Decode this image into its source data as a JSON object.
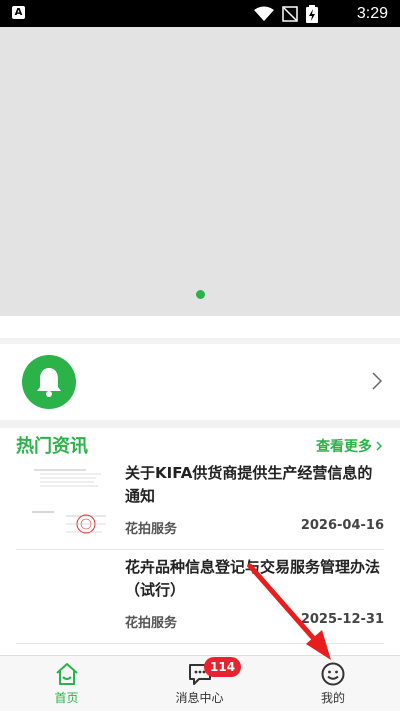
{
  "status_bar": {
    "app_icon_letter": "A",
    "time": "3:29",
    "icons": [
      "wifi-icon",
      "no-signal-icon",
      "battery-charging-icon"
    ]
  },
  "banner": {
    "indicator_count": 1,
    "active_index": 0
  },
  "notice": {
    "icon": "bell-icon"
  },
  "news": {
    "title": "热门资讯",
    "more_label": "查看更多",
    "items": [
      {
        "headline": "关于KIFA供货商提供生产经营信息的通知",
        "source": "花拍服务",
        "date": "2026-04-16"
      },
      {
        "headline": "花卉品种信息登记与交易服务管理办法（试行）",
        "source": "花拍服务",
        "date": "2025-12-31"
      }
    ]
  },
  "tabbar": {
    "tabs": [
      {
        "label": "首页",
        "icon": "home-icon",
        "active": true
      },
      {
        "label": "消息中心",
        "icon": "message-icon",
        "badge": "114"
      },
      {
        "label": "我的",
        "icon": "smiley-icon"
      }
    ]
  },
  "colors": {
    "accent": "#2bb34a",
    "badge": "#e8222e",
    "annotation_arrow": "#e81e1e"
  }
}
